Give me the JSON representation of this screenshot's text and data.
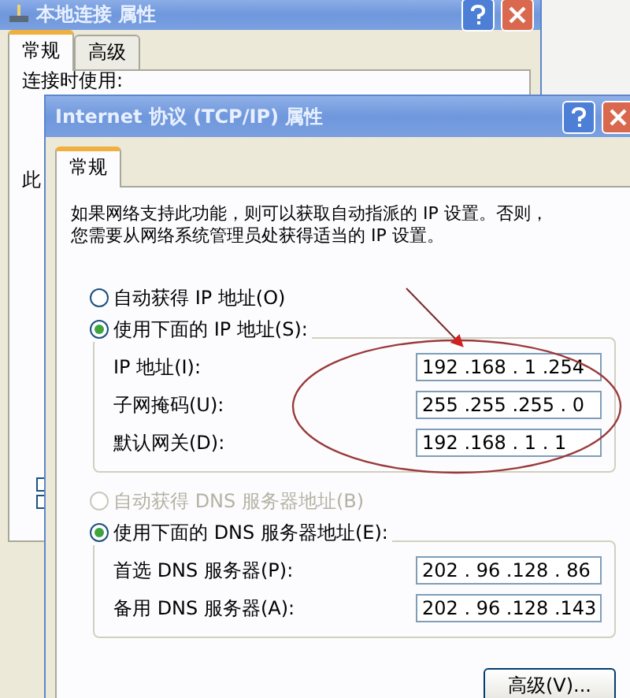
{
  "back_window": {
    "title": "本地连接 属性",
    "tabs": [
      {
        "label": "常规",
        "selected": true
      },
      {
        "label": "高级",
        "selected": false
      }
    ],
    "connect_label": "连接时使用:",
    "side_label": "此"
  },
  "window": {
    "title": "Internet 协议 (TCP/IP) 属性",
    "tabs": [
      {
        "label": "常规",
        "selected": true
      }
    ],
    "description_lines": [
      "如果网络支持此功能，则可以获取自动指派的 IP 设置。否则，",
      "您需要从网络系统管理员处获得适当的 IP 设置。"
    ],
    "ip_options": [
      {
        "label": "自动获得 IP 地址(O)",
        "selected": false,
        "disabled": false
      },
      {
        "label": "使用下面的 IP 地址(S):",
        "selected": true,
        "disabled": false
      }
    ],
    "ip_fields": [
      {
        "label": "IP 地址(I):",
        "value": "192 .168 . 1 .254"
      },
      {
        "label": "子网掩码(U):",
        "value": "255 .255 .255 . 0"
      },
      {
        "label": "默认网关(D):",
        "value": "192 .168 . 1 . 1"
      }
    ],
    "dns_options": [
      {
        "label": "自动获得 DNS 服务器地址(B)",
        "selected": false,
        "disabled": true
      },
      {
        "label": "使用下面的 DNS 服务器地址(E):",
        "selected": true,
        "disabled": false
      }
    ],
    "dns_fields": [
      {
        "label": "首选 DNS 服务器(P):",
        "value": "202 . 96 .128 . 86"
      },
      {
        "label": "备用 DNS 服务器(A):",
        "value": "202 . 96 .128 .143"
      }
    ],
    "advanced_button": "高级(V)..."
  }
}
